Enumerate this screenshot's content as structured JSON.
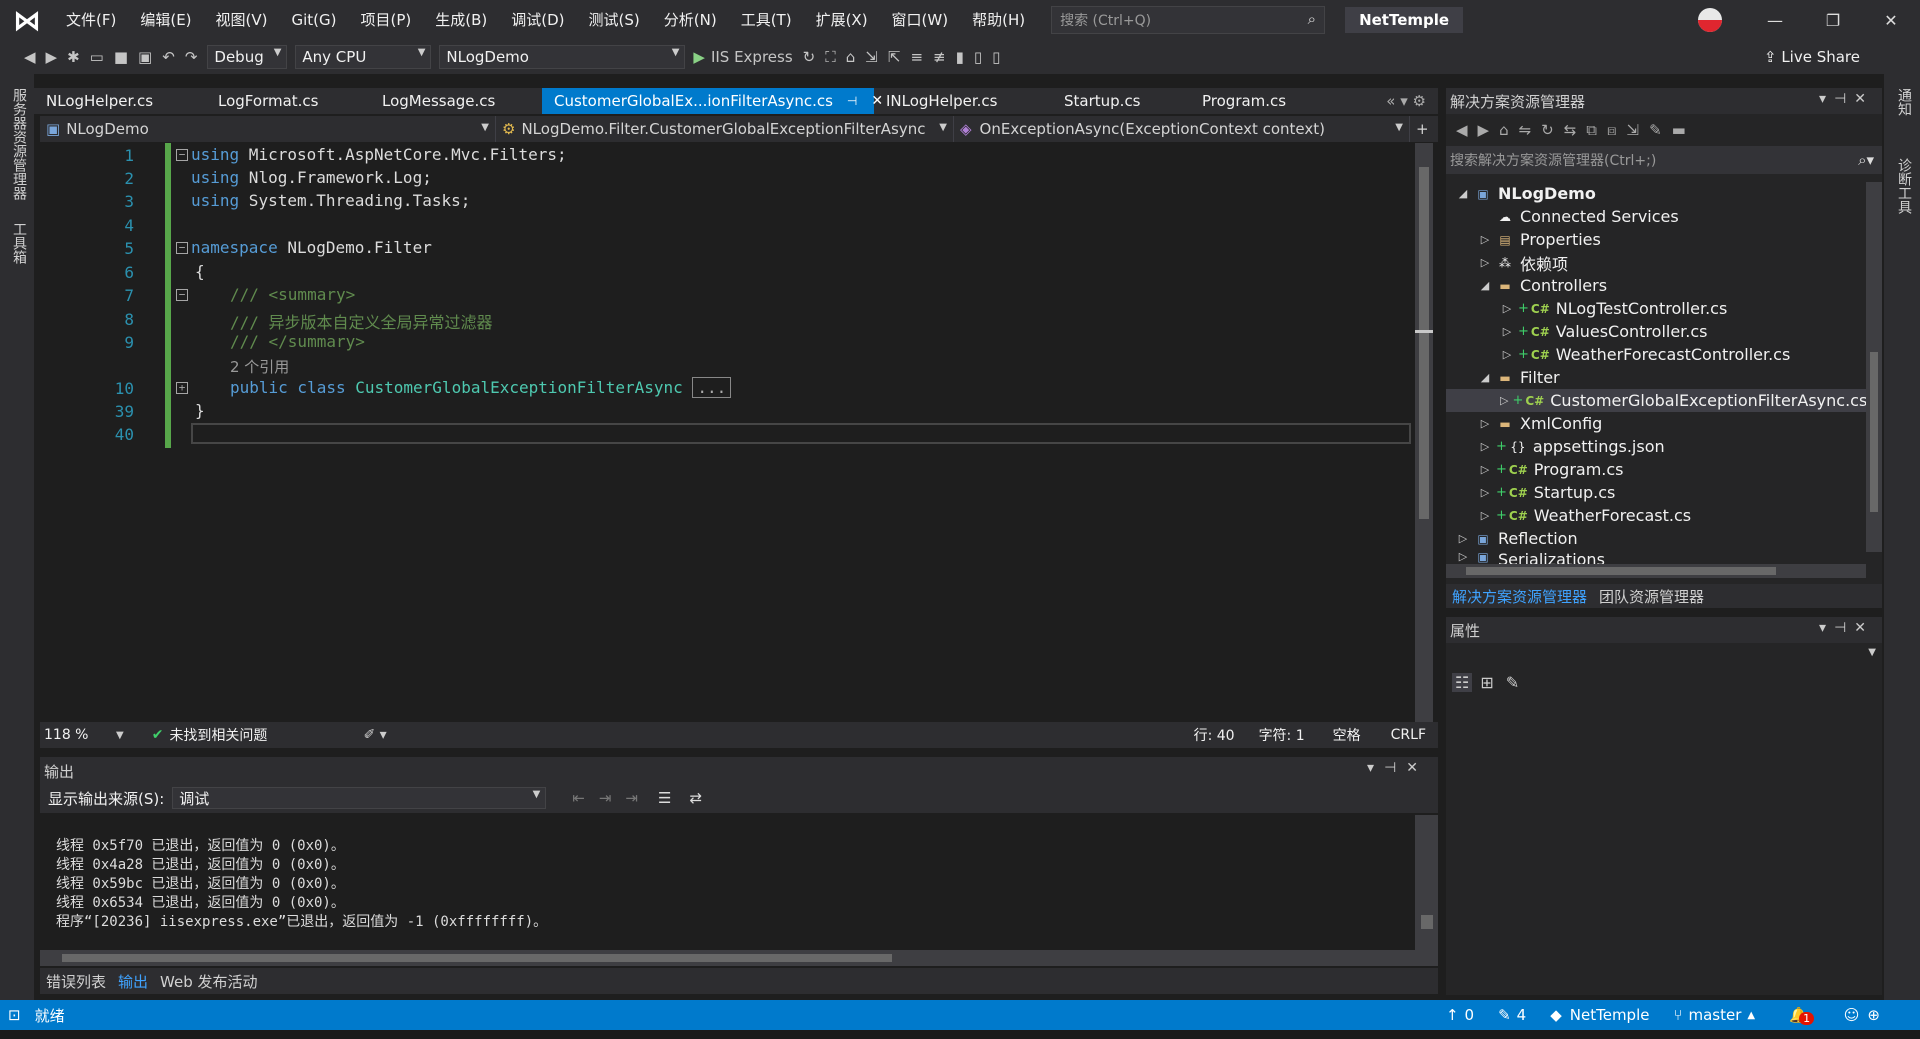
{
  "titlebar": {
    "menu": [
      "文件(F)",
      "编辑(E)",
      "视图(V)",
      "Git(G)",
      "项目(P)",
      "生成(B)",
      "调试(D)",
      "测试(S)",
      "分析(N)",
      "工具(T)",
      "扩展(X)",
      "窗口(W)",
      "帮助(H)"
    ],
    "search_placeholder": "搜索 (Ctrl+Q)",
    "solution_name": "NetTemple"
  },
  "toolbar": {
    "config": "Debug",
    "platform": "Any CPU",
    "startup_project": "NLogDemo",
    "run_label": "IIS Express",
    "live_share": "Live Share"
  },
  "left_tabs": [
    "服务器资源管理器",
    "工具箱"
  ],
  "right_tabs": [
    "通知",
    "诊断工具"
  ],
  "doc_tabs": [
    {
      "label": "NLogHelper.cs"
    },
    {
      "label": "LogFormat.cs"
    },
    {
      "label": "LogMessage.cs"
    },
    {
      "label": "CustomerGlobalEx...ionFilterAsync.cs",
      "active": true
    },
    {
      "label": "INLogHelper.cs"
    },
    {
      "label": "Startup.cs"
    },
    {
      "label": "Program.cs"
    }
  ],
  "navbar": {
    "project": "NLogDemo",
    "type": "NLogDemo.Filter.CustomerGlobalExceptionFilterAsync",
    "member": "OnExceptionAsync(ExceptionContext context)"
  },
  "editor": {
    "line_numbers": [
      "1",
      "2",
      "3",
      "4",
      "5",
      "6",
      "7",
      "8",
      "9",
      "10",
      "39",
      "40"
    ],
    "lines": {
      "l1_kw": "using",
      "l1_rest": " Microsoft.AspNetCore.Mvc.Filters;",
      "l2_kw": "using",
      "l2_rest": " Nlog.Framework.Log;",
      "l3_kw": "using",
      "l3_rest": " System.Threading.Tasks;",
      "l5_kw": "namespace",
      "l5_rest": " NLogDemo.Filter",
      "l6": "{",
      "l7": "/// <summary>",
      "l8": "/// 异步版本自定义全局异常过滤器",
      "l9": "/// </summary>",
      "ref": "2 个引用",
      "l10_kw": "public class",
      "l10_type": "CustomerGlobalExceptionFilterAsync",
      "l10_collapsed": "...",
      "l39": "}"
    }
  },
  "editor_status": {
    "zoom": "118 %",
    "issues": "未找到相关问题",
    "line": "行: 40",
    "char": "字符: 1",
    "spaces": "空格",
    "eol": "CRLF"
  },
  "output": {
    "title": "输出",
    "source_label": "显示输出来源(S):",
    "source_value": "调试",
    "lines": [
      "线程 0x5f70 已退出，返回值为 0 (0x0)。",
      "线程 0x4a28 已退出，返回值为 0 (0x0)。",
      "线程 0x59bc 已退出，返回值为 0 (0x0)。",
      "线程 0x6534 已退出，返回值为 0 (0x0)。",
      "程序“[20236] iisexpress.exe”已退出，返回值为 -1 (0xffffffff)。"
    ]
  },
  "bottom_tabs": [
    "错误列表",
    "输出",
    "Web 发布活动"
  ],
  "solution_explorer": {
    "title": "解决方案资源管理器",
    "search_placeholder": "搜索解决方案资源管理器(Ctrl+;)",
    "nodes": [
      "NLogDemo",
      "Connected Services",
      "Properties",
      "依赖项",
      "Controllers",
      "NLogTestController.cs",
      "ValuesController.cs",
      "WeatherForecastController.cs",
      "Filter",
      "CustomerGlobalExceptionFilterAsync.cs",
      "XmlConfig",
      "appsettings.json",
      "Program.cs",
      "Startup.cs",
      "WeatherForecast.cs",
      "Reflection",
      "Serializations"
    ],
    "tabs": [
      "解决方案资源管理器",
      "团队资源管理器"
    ]
  },
  "properties": {
    "title": "属性"
  },
  "statusbar": {
    "ready": "就绪",
    "up_count": "0",
    "edit_count": "4",
    "repo": "NetTemple",
    "branch": "master",
    "notif": "1"
  },
  "colors": {
    "accent": "#007acc",
    "keyword": "#569cd6",
    "comment": "#57a64a",
    "type": "#4ec9b0",
    "linenum": "#2b91af"
  }
}
